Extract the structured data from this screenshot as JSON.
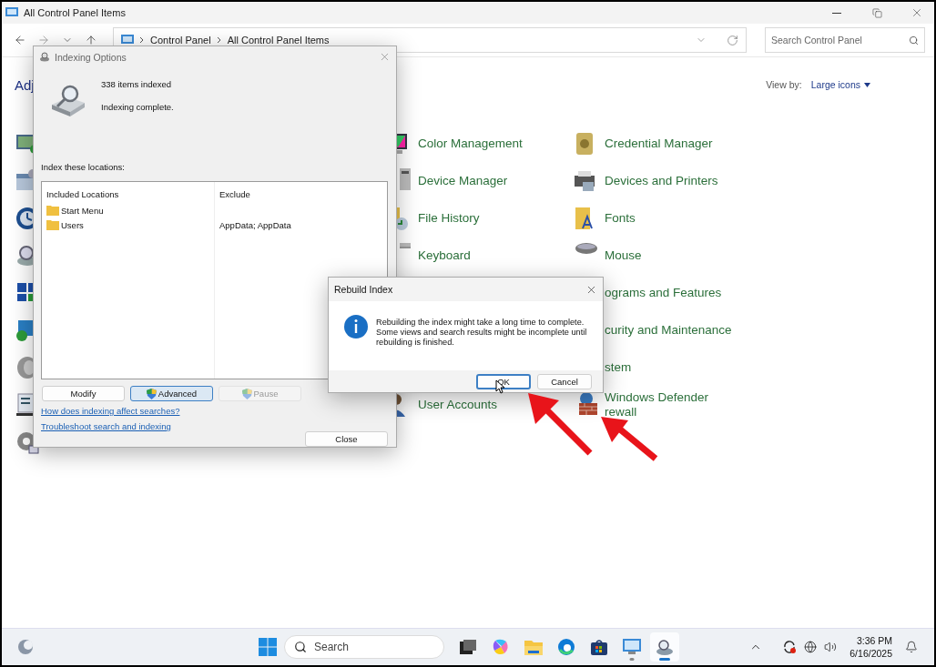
{
  "window": {
    "title": "All Control Panel Items"
  },
  "address_bar": {
    "path": [
      "Control Panel",
      "All Control Panel Items"
    ]
  },
  "search": {
    "placeholder": "Search Control Panel"
  },
  "heading": "Adj",
  "view_by": {
    "label": "View by:",
    "value": "Large icons"
  },
  "items_column_2": [
    "Color Management",
    "Device Manager",
    "File History",
    "Keyboard"
  ],
  "items_column_2_lower": [
    "User Accounts"
  ],
  "items_column_3": [
    {
      "kind": "icon",
      "lines": [
        "Credential Manager"
      ]
    },
    {
      "kind": "icon",
      "lines": [
        "Devices and Printers"
      ]
    },
    {
      "kind": "icon",
      "lines": [
        "Fonts"
      ]
    },
    {
      "kind": "icon",
      "lines": [
        "Mouse"
      ]
    },
    {
      "kind": "text",
      "lines": [
        "ograms and Features"
      ]
    },
    {
      "kind": "text",
      "lines": [
        "curity and Maintenance"
      ]
    },
    {
      "kind": "text",
      "lines": [
        "stem"
      ]
    },
    {
      "kind": "icon",
      "lines": [
        "Windows Defender",
        "rewall"
      ]
    }
  ],
  "indexing_dialog": {
    "title": "Indexing Options",
    "count": "338 items indexed",
    "status": "Indexing complete.",
    "locations_label": "Index these locations:",
    "columns": [
      "Included Locations",
      "Exclude"
    ],
    "rows": [
      {
        "location": "Start Menu"
      },
      {
        "location": "Users",
        "exclude": "AppData; AppData"
      }
    ],
    "buttons": [
      {
        "label": "Modify",
        "kind": "plain",
        "focused": false,
        "disabled": false
      },
      {
        "label": "Advanced",
        "kind": "shield",
        "focused": true,
        "disabled": false
      },
      {
        "label": "Pause",
        "kind": "shield",
        "focused": false,
        "disabled": true
      }
    ],
    "links": [
      "How does indexing affect searches?",
      "Troubleshoot search and indexing"
    ],
    "close_button": "Close"
  },
  "rebuild_dialog": {
    "title": "Rebuild Index",
    "message": "Rebuilding the index might take a long time to complete.\nSome views and search results might be incomplete until\nrebuilding is finished.",
    "buttons": [
      {
        "label": "OK",
        "focused": true
      },
      {
        "label": "Cancel",
        "focused": false
      }
    ]
  },
  "taskbar": {
    "search_placeholder": "Search",
    "apps": [
      {
        "running": false,
        "selected": false
      },
      {
        "running": false,
        "selected": false
      },
      {
        "running": false,
        "selected": false
      },
      {
        "running": false,
        "selected": false
      },
      {
        "running": false,
        "selected": false
      },
      {
        "running": true,
        "selected": false
      },
      {
        "running": true,
        "selected": true
      }
    ],
    "time": "3:36 PM",
    "date": "6/16/2025"
  }
}
